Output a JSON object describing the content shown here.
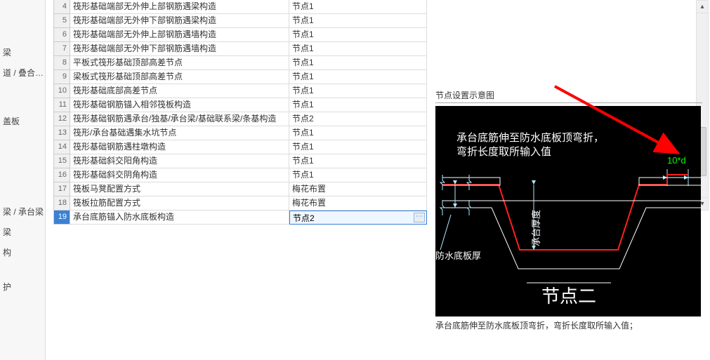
{
  "sidebar": {
    "items": [
      {
        "label": "梁"
      },
      {
        "label": "道 / 叠合…"
      },
      {
        "label": ""
      },
      {
        "label": "盖板"
      },
      {
        "label": ""
      },
      {
        "label": ""
      },
      {
        "label": ""
      },
      {
        "label": "梁 / 承台梁"
      },
      {
        "label": "梁"
      },
      {
        "label": "构"
      },
      {
        "label": ""
      },
      {
        "label": "护"
      }
    ]
  },
  "table": {
    "rows": [
      {
        "n": "4",
        "name": "筏形基础端部无外伸上部钢筋遇梁构造",
        "val": "节点1"
      },
      {
        "n": "5",
        "name": "筏形基础端部无外伸下部钢筋遇梁构造",
        "val": "节点1"
      },
      {
        "n": "6",
        "name": "筏形基础端部无外伸上部钢筋遇墙构造",
        "val": "节点1"
      },
      {
        "n": "7",
        "name": "筏形基础端部无外伸下部钢筋遇墙构造",
        "val": "节点1"
      },
      {
        "n": "8",
        "name": "平板式筏形基础顶部高差节点",
        "val": "节点1"
      },
      {
        "n": "9",
        "name": "梁板式筏形基础顶部高差节点",
        "val": "节点1"
      },
      {
        "n": "10",
        "name": "筏形基础底部高差节点",
        "val": "节点1"
      },
      {
        "n": "11",
        "name": "筏形基础钢筋锚入相邻筏板构造",
        "val": "节点1"
      },
      {
        "n": "12",
        "name": "筏形基础钢筋遇承台/独基/承台梁/基础联系梁/条基构造",
        "val": "节点2"
      },
      {
        "n": "13",
        "name": "筏形/承台基础遇集水坑节点",
        "val": "节点1"
      },
      {
        "n": "14",
        "name": "筏形基础钢筋遇柱墩构造",
        "val": "节点1"
      },
      {
        "n": "15",
        "name": "筏形基础斜交阳角构造",
        "val": "节点1"
      },
      {
        "n": "16",
        "name": "筏形基础斜交阴角构造",
        "val": "节点1"
      },
      {
        "n": "17",
        "name": "筏板马凳配置方式",
        "val": "梅花布置"
      },
      {
        "n": "18",
        "name": "筏板拉筋配置方式",
        "val": "梅花布置"
      }
    ],
    "selected": {
      "n": "19",
      "name": "承台底筋锚入防水底板构造",
      "input_value": "节点2",
      "ellipsis": "⋯"
    }
  },
  "diagram": {
    "title": "节点设置示意图",
    "desc_line1": "承台底筋伸至防水底板顶弯折，",
    "desc_line2": "弯折长度取所输入值",
    "dim_top_right": "10*d",
    "label_thick": "防水底板厚",
    "label_cap": "承台厚度",
    "footer_title": "节点二",
    "caption": "承台底筋伸至防水底板顶弯折，弯折长度取所输入值；"
  }
}
